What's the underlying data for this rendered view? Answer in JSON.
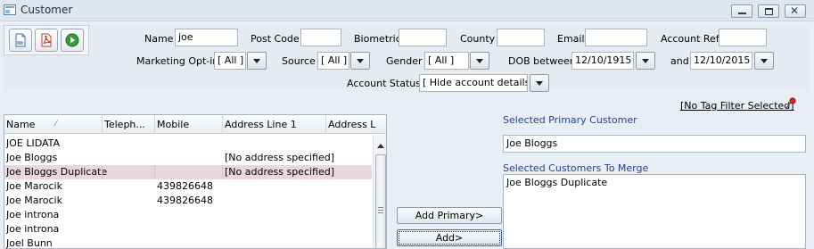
{
  "window": {
    "title": "Customer",
    "min_label": "",
    "max_label": "",
    "close_label": "✕"
  },
  "toolbar": {
    "new_icon": "new-document-icon",
    "pdf_icon": "pdf-icon",
    "go_icon": "go-arrow-icon"
  },
  "search": {
    "name_label": "Name",
    "name_value": "joe",
    "postcode_label": "Post Code",
    "postcode_value": "",
    "biometric_label": "Biometric",
    "biometric_value": "",
    "county_label": "County",
    "county_value": "",
    "email_label": "Email",
    "email_value": "",
    "accountref_label": "Account Ref",
    "accountref_value": "",
    "marketing_label": "Marketing Opt-in",
    "marketing_value": "[ All ]",
    "source_label": "Source",
    "source_value": "[ All ]",
    "gender_label": "Gender",
    "gender_value": "[ All ]",
    "dob_label": "DOB between",
    "dob_from": "12/10/1915",
    "and_label": "and",
    "dob_to": "12/10/2015",
    "status_label": "Account Status",
    "status_value": "[ Hide account details ]"
  },
  "grid": {
    "columns": [
      "Name",
      "Teleph...",
      "Mobile",
      "Address Line 1",
      "Address L"
    ],
    "sort_indicator": "⁄",
    "rows": [
      {
        "name": "JOE LIDATA",
        "telephone": "",
        "mobile": "",
        "address1": "",
        "selected": false
      },
      {
        "name": "Joe Bloggs",
        "telephone": "",
        "mobile": "",
        "address1": "[No address specified]",
        "selected": false
      },
      {
        "name": "Joe Bloggs Duplicate",
        "telephone": "",
        "mobile": "",
        "address1": "[No address specified]",
        "selected": true
      },
      {
        "name": "Joe Marocik",
        "telephone": "",
        "mobile": "439826648",
        "address1": "",
        "selected": false
      },
      {
        "name": "Joe Marocik",
        "telephone": "",
        "mobile": "439826648",
        "address1": "",
        "selected": false
      },
      {
        "name": "Joe introna",
        "telephone": "",
        "mobile": "",
        "address1": "",
        "selected": false
      },
      {
        "name": "Joe introna",
        "telephone": "",
        "mobile": "",
        "address1": "",
        "selected": false
      },
      {
        "name": "Joel Bunn",
        "telephone": "",
        "mobile": "",
        "address1": "",
        "selected": false
      }
    ]
  },
  "actions": {
    "add_primary": "Add Primary>",
    "add": "Add>"
  },
  "merge": {
    "tag_filter": "[No Tag Filter Selected]",
    "primary_label": "Selected Primary Customer",
    "primary_value": "Joe Bloggs",
    "merge_label": "Selected Customers To Merge",
    "merge_items": [
      "Joe Bloggs Duplicate"
    ]
  },
  "colors": {
    "selected_row": "#e8d7dc",
    "section_label": "#2a3f8f"
  }
}
